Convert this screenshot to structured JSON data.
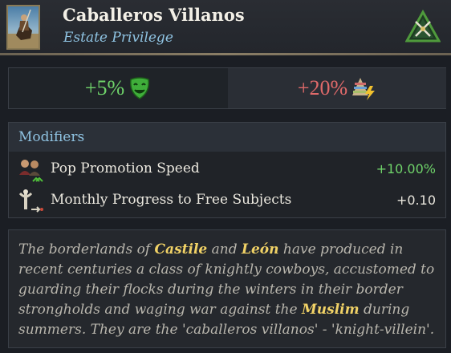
{
  "header": {
    "title": "Caballeros Villanos",
    "subtitle": "Estate Privilege",
    "portrait_icon": "knight-portrait-icon",
    "type_icon": "weapons-triangle-icon"
  },
  "stats": [
    {
      "value": "+5%",
      "icon": "happy-mask-icon",
      "color": "#6fd36a"
    },
    {
      "value": "+20%",
      "icon": "pyramid-lightning-icon",
      "color": "#e06a6a"
    }
  ],
  "modifiers": {
    "title": "Modifiers",
    "items": [
      {
        "label": "Pop Promotion Speed",
        "value": "+10.00%",
        "icon": "pops-promotion-icon",
        "value_color": "#6fd36a"
      },
      {
        "label": "Monthly Progress to Free Subjects",
        "value": "+0.10",
        "icon": "free-subjects-icon",
        "value_color": "#e9e6dd"
      }
    ]
  },
  "description": {
    "p1": "The borderlands of ",
    "h1": "Castile",
    "p2": " and ",
    "h2": "León",
    "p3": " have produced in recent centuries a class of knightly cowboys, accustomed to guarding their flocks during the winters in their border strongholds and waging war against the ",
    "h3": "Muslim",
    "p4": " during summers. They are the 'caballeros villanos' - 'knight-villein'."
  }
}
